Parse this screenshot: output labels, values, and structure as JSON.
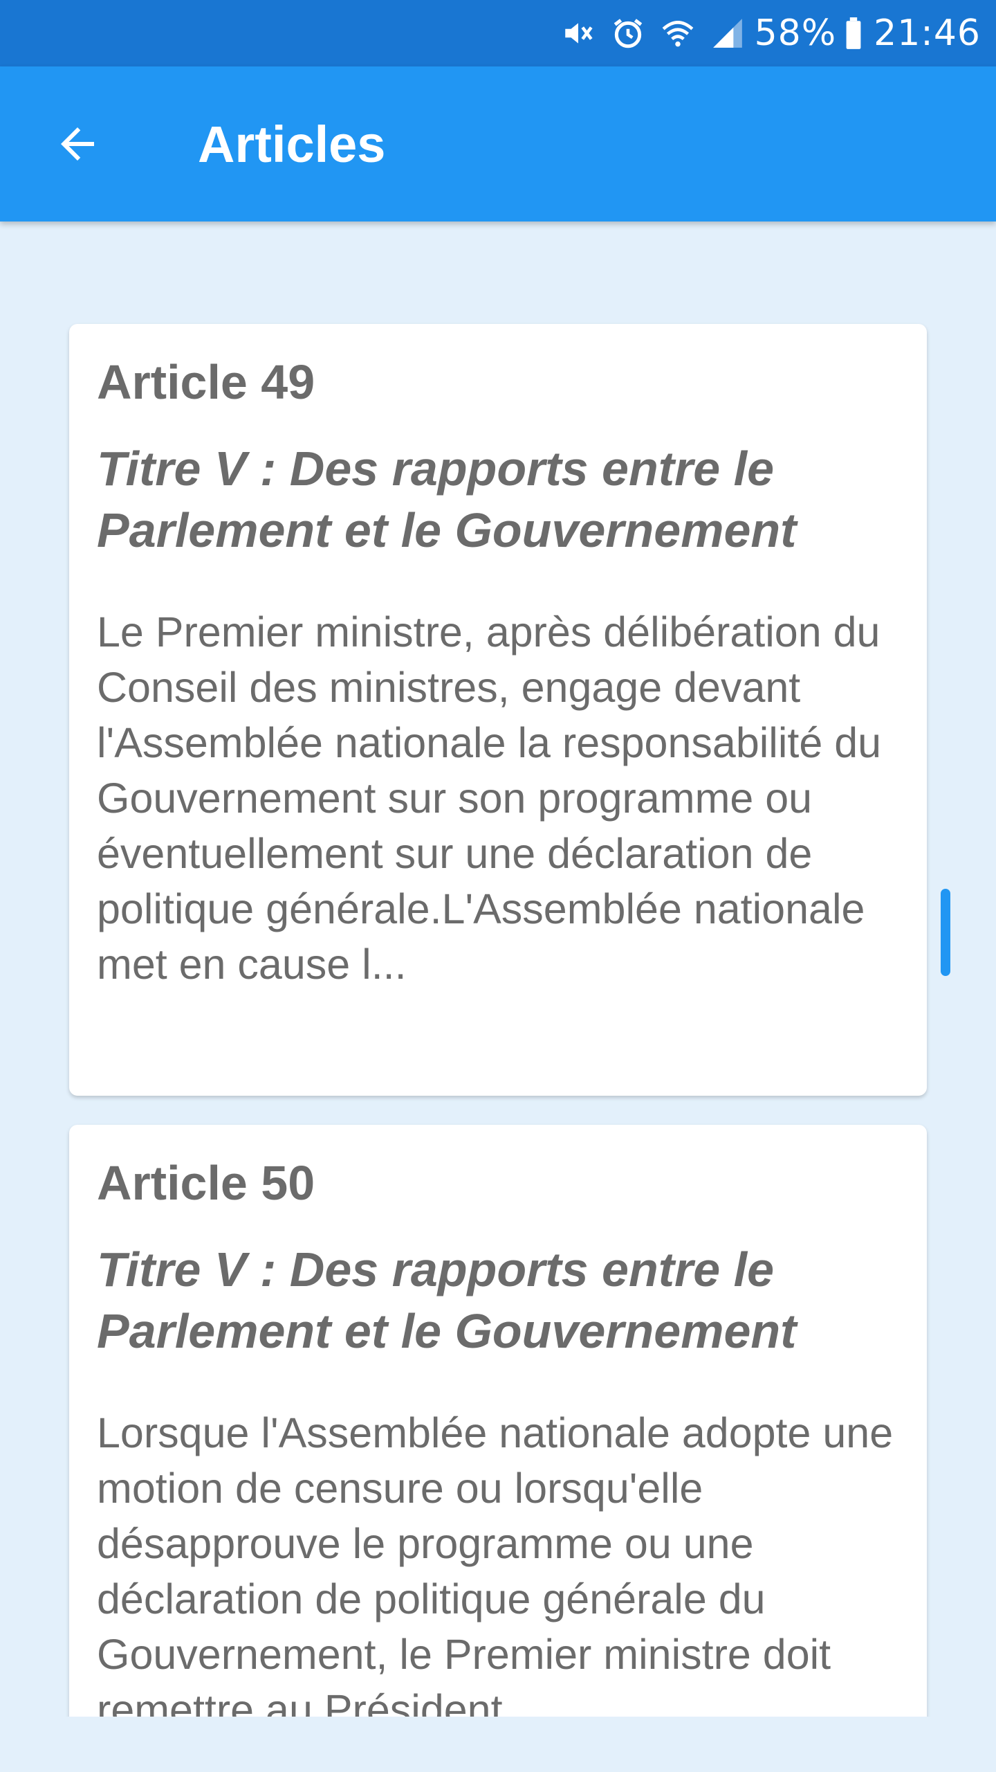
{
  "status_bar": {
    "battery": "58%",
    "time": "21:46",
    "icons": [
      "mute-icon",
      "alarm-icon",
      "wifi-icon",
      "signal-icon",
      "battery-icon"
    ]
  },
  "app_bar": {
    "title": "Articles",
    "back_icon": "arrow-back-icon"
  },
  "articles": [
    {
      "title": "Article 49",
      "section": "Titre V : Des rapports entre le Parlement et le Gouvernement",
      "excerpt": "Le Premier ministre, après délibération du Conseil des ministres, engage devant l'Assemblée nationale la responsabilité du Gouvernement sur son programme ou éventuellement sur une déclaration de politique générale.L'Assemblée nationale met en cause l..."
    },
    {
      "title": "Article 50",
      "section": "Titre V : Des rapports entre le Parlement et le Gouvernement",
      "excerpt": "Lorsque l'Assemblée nationale adopte une motion de censure ou lorsqu'elle désapprouve le programme ou une déclaration de politique générale du Gouvernement, le Premier ministre doit remettre au Président"
    }
  ],
  "colors": {
    "status_bar": "#1976d2",
    "app_bar": "#2196f3",
    "background": "#e3f0fb",
    "card": "#ffffff",
    "text": "#6b6b6b",
    "scroll_indicator": "#2196f3"
  }
}
